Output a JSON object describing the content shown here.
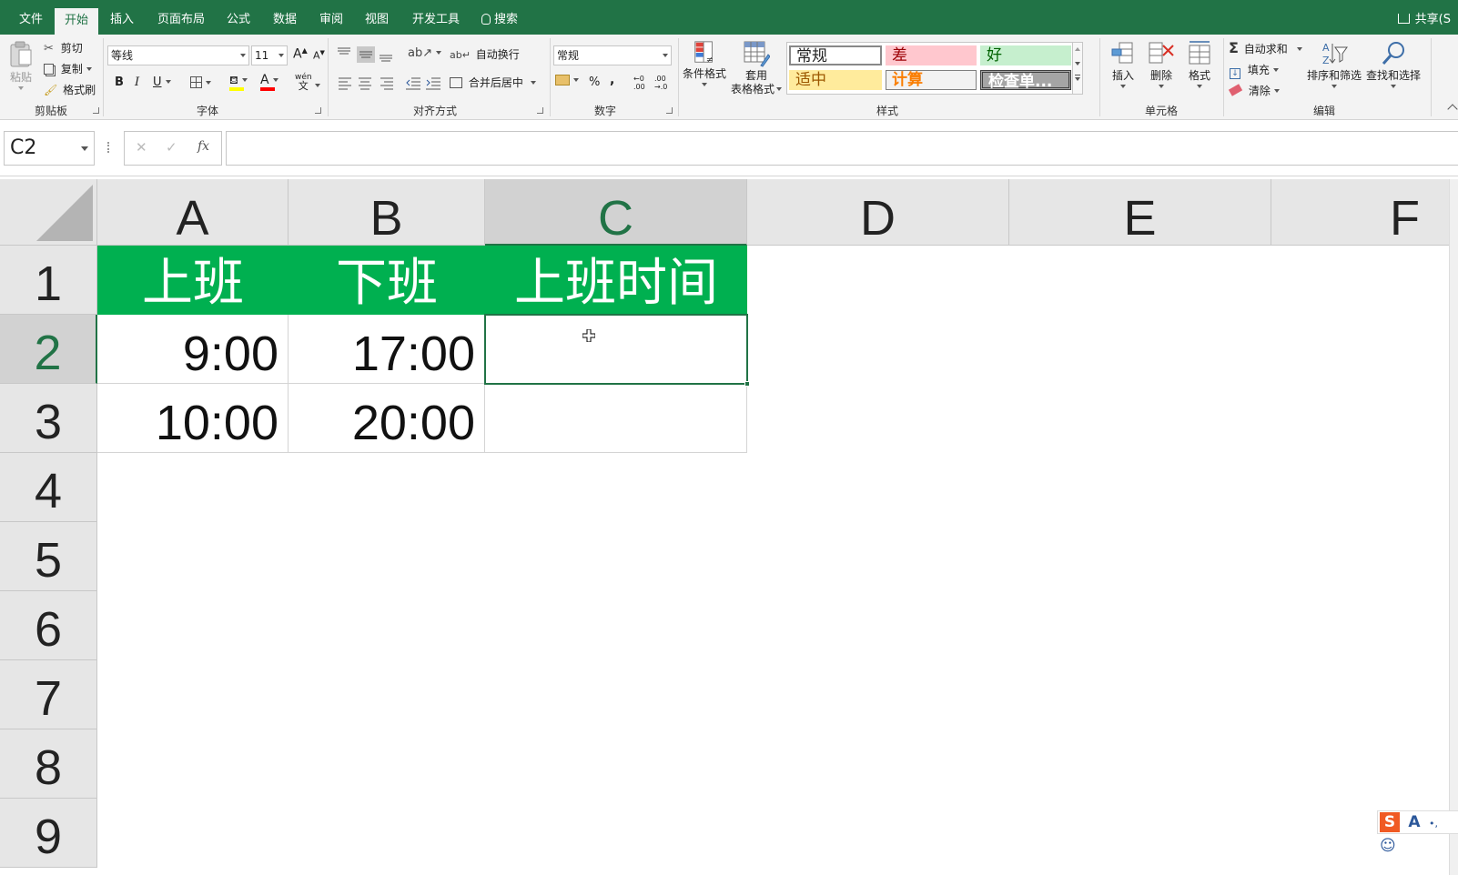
{
  "tabs": [
    {
      "label": "文件",
      "active": false
    },
    {
      "label": "开始",
      "active": true
    },
    {
      "label": "插入",
      "active": false
    },
    {
      "label": "页面布局",
      "active": false
    },
    {
      "label": "公式",
      "active": false
    },
    {
      "label": "数据",
      "active": false
    },
    {
      "label": "审阅",
      "active": false
    },
    {
      "label": "视图",
      "active": false
    },
    {
      "label": "开发工具",
      "active": false
    },
    {
      "label": "搜索",
      "active": false
    }
  ],
  "share_label": "共享(S",
  "clipboard": {
    "group": "剪贴板",
    "paste": "粘贴",
    "cut": "剪切",
    "copy": "复制",
    "format_painter": "格式刷"
  },
  "font": {
    "group": "字体",
    "name": "等线",
    "size": "11",
    "bold": "B",
    "italic": "I",
    "underline": "U",
    "grow": "A",
    "shrink": "A",
    "font_color_letter": "A",
    "phonetic_top": "wén",
    "phonetic_bottom": "文",
    "fill_color": "#ffff00",
    "font_color": "#ff0000"
  },
  "alignment": {
    "group": "对齐方式",
    "wrap_text": "自动换行",
    "merge_center": "合并后居中"
  },
  "number": {
    "group": "数字",
    "format": "常规",
    "percent": "%",
    "comma": ",",
    "inc_decimal_top": "←0",
    "inc_decimal_bottom": ".00",
    "dec_decimal_top": ".00",
    "dec_decimal_bottom": "→.0"
  },
  "styles": {
    "group": "样式",
    "conditional": "条件格式",
    "table_format_1": "套用",
    "table_format_2": "表格格式",
    "gallery": [
      {
        "label": "常规",
        "bg": "#ffffff",
        "fg": "#222222"
      },
      {
        "label": "差",
        "bg": "#ffc7ce",
        "fg": "#9c0006"
      },
      {
        "label": "好",
        "bg": "#c6efce",
        "fg": "#006100"
      },
      {
        "label": "适中",
        "bg": "#ffeb9c",
        "fg": "#9c5700"
      },
      {
        "label": "计算",
        "bg": "#f2f2f2",
        "fg": "#fa7d00"
      },
      {
        "label": "检查单...",
        "bg": "#a5a5a5",
        "fg": "#ffffff"
      }
    ]
  },
  "cells_group": {
    "group": "单元格",
    "insert": "插入",
    "delete": "删除",
    "format": "格式"
  },
  "editing": {
    "group": "编辑",
    "autosum": "自动求和",
    "fill": "填充",
    "clear": "清除",
    "sort_filter": "排序和筛选",
    "find_select": "查找和选择"
  },
  "formula_bar": {
    "name_box": "C2",
    "cancel": "✕",
    "enter": "✓",
    "fx": "fx",
    "value": ""
  },
  "sheet": {
    "columns": [
      "A",
      "B",
      "C",
      "D",
      "E",
      "F"
    ],
    "rows": [
      "1",
      "2",
      "3",
      "4",
      "5",
      "6",
      "7",
      "8",
      "9"
    ],
    "header_row": [
      "上班",
      "下班",
      "上班时间"
    ],
    "data": [
      [
        "9:00",
        "17:00",
        ""
      ],
      [
        "10:00",
        "20:00",
        ""
      ]
    ],
    "header_fill": "#00b050",
    "selected_cell": "C2"
  },
  "ime": {
    "logo": "S",
    "mode": "A",
    "punct": "•,",
    "emoji": "☺"
  }
}
